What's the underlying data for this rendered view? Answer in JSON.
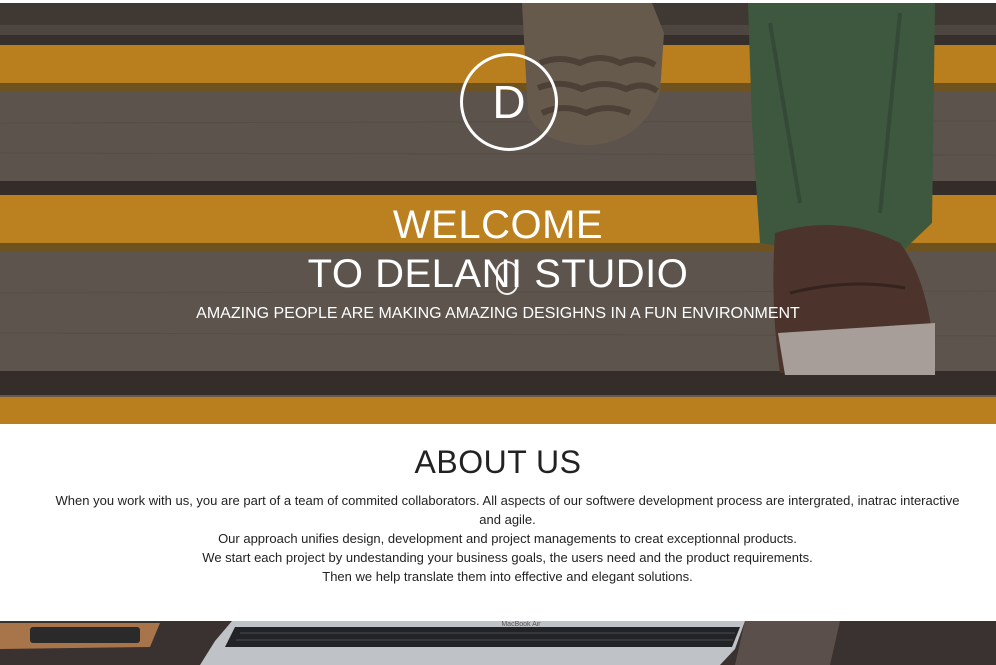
{
  "hero": {
    "logo_letter": "D",
    "title_line1": "WELCOME",
    "title_line2": "TO DELANI STUDIO",
    "subtitle": "AMAZING PEOPLE ARE MAKING AMAZING DESIGHNS IN A FUN ENVIRONMENT"
  },
  "about": {
    "heading": "ABOUT US",
    "paragraphs": [
      "When you work with us, you are part of a team of commited collaborators. All aspects of our softwere development process are intergrated, inatrac interactive and agile.",
      "Our approach unifies design, development and project managements to creat exceptionnal products.",
      "We start each project by undestanding your business goals, the users need and the product requirements.",
      "Then we help translate them into effective and elegant solutions."
    ]
  },
  "laptop": {
    "brand_text": "MacBook Air"
  },
  "colors": {
    "stair_yellow": "#f2a51c",
    "stair_gray": "#6f6a5c",
    "text_dark": "#222222"
  }
}
